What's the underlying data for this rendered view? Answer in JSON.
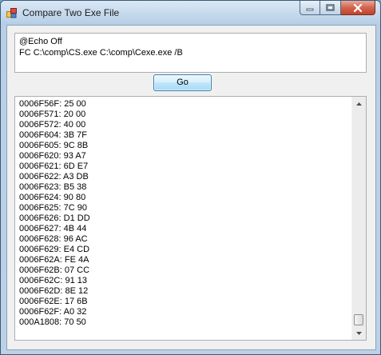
{
  "window": {
    "title": "Compare Two Exe File",
    "icon": "app-window-icon",
    "controls": [
      "minimize-icon",
      "maximize-icon",
      "close-icon"
    ]
  },
  "command": {
    "lines": [
      "@Echo Off",
      "FC C:\\comp\\CS.exe C:\\comp\\Cexe.exe /B"
    ]
  },
  "go_button": {
    "label": "Go"
  },
  "output": {
    "lines": [
      "0006F56F: 25 00",
      "0006F571: 20 00",
      "0006F572: 40 00",
      "0006F604: 3B 7F",
      "0006F605: 9C 8B",
      "0006F620: 93 A7",
      "0006F621: 6D E7",
      "0006F622: A3 DB",
      "0006F623: B5 38",
      "0006F624: 90 80",
      "0006F625: 7C 90",
      "0006F626: D1 DD",
      "0006F627: 4B 44",
      "0006F628: 96 AC",
      "0006F629: E4 CD",
      "0006F62A: FE 4A",
      "0006F62B: 07 CC",
      "0006F62C: 91 13",
      "0006F62D: 8E 12",
      "0006F62E: 17 6B",
      "0006F62F: A0 32",
      "000A1808: 70 50"
    ]
  },
  "colors": {
    "accent": "#3c7fb1",
    "close": "#c0432c"
  }
}
